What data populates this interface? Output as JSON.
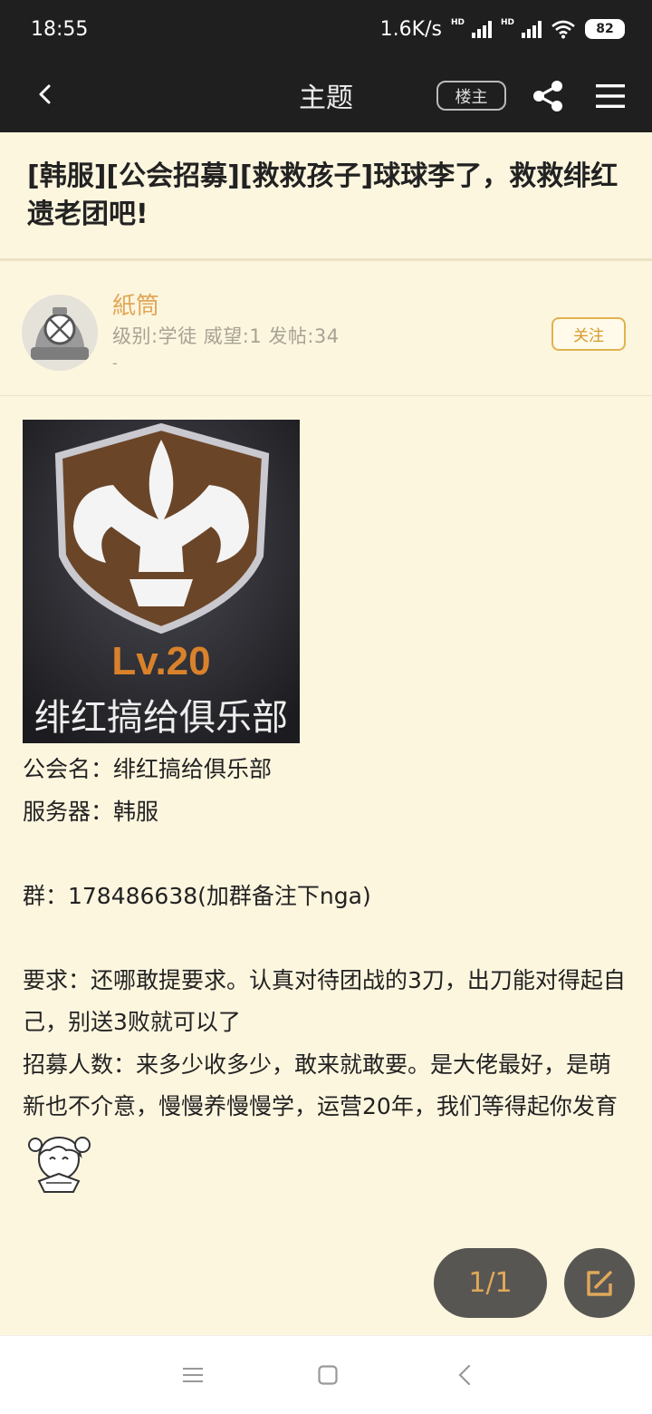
{
  "status_bar": {
    "time": "18:55",
    "network_speed": "1.6K/s",
    "hd_label": "HD",
    "battery": "82"
  },
  "nav": {
    "title": "主题",
    "op_badge": "楼主",
    "icons": [
      "back-icon",
      "share-icon",
      "menu-icon"
    ]
  },
  "post": {
    "title": "[韩服][公会招募][救救孩子]球球李了，救救绯红遗老团吧!"
  },
  "author": {
    "name": "紙筒",
    "meta": "级别:学徒 威望:1 发帖:34",
    "extra": "-",
    "follow_label": "关注"
  },
  "image": {
    "level_text": "Lv.20",
    "guild_text": "绯红搞给俱乐部"
  },
  "content": {
    "lines": [
      "公会名：绯红搞给俱乐部",
      "服务器：韩服",
      "",
      "群：178486638(加群备注下nga)",
      "",
      "要求：还哪敢提要求。认真对待团战的3刀，出刀能对得起自己，别送3败就可以了",
      "招募人数：来多少收多少，敢来就敢要。是大佬最好，是萌新也不介意，慢慢养慢慢学，运营20年，我们等得起你发育"
    ]
  },
  "pager": {
    "label": "1/1"
  },
  "colors": {
    "background": "#fdf6df",
    "bar": "#1f1f1f",
    "accent": "#e0a85a",
    "fab": "#585652"
  }
}
